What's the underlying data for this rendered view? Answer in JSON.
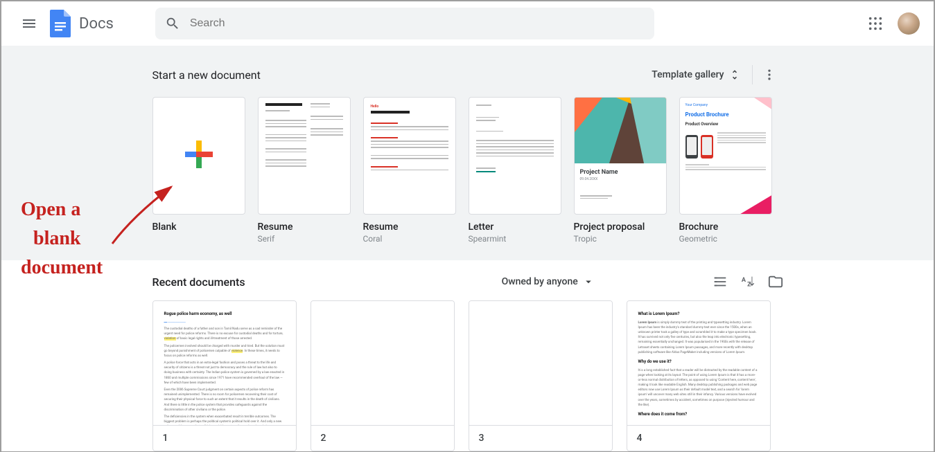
{
  "app": {
    "title": "Docs"
  },
  "search": {
    "placeholder": "Search"
  },
  "templates": {
    "section_title": "Start a new document",
    "gallery_label": "Template gallery",
    "items": [
      {
        "name": "Blank",
        "sub": ""
      },
      {
        "name": "Resume",
        "sub": "Serif"
      },
      {
        "name": "Resume",
        "sub": "Coral"
      },
      {
        "name": "Letter",
        "sub": "Spearmint"
      },
      {
        "name": "Project proposal",
        "sub": "Tropic"
      },
      {
        "name": "Brochure",
        "sub": "Geometric"
      }
    ],
    "proposal_thumb_title": "Project Name",
    "brochure_thumb_company": "Your Company",
    "brochure_thumb_title": "Product Brochure",
    "brochure_thumb_overview": "Product Overview"
  },
  "recent": {
    "section_title": "Recent documents",
    "owned_label": "Owned by anyone",
    "items": [
      {
        "label": "1",
        "heading": "Rogue police harm economy, as well",
        "sub_h2": "",
        "sub_h3": ""
      },
      {
        "label": "2"
      },
      {
        "label": "3"
      },
      {
        "label": "4",
        "heading": "What is Lorem Ipsum?",
        "sub_h2": "Why do we use it?",
        "sub_h3": "Where does it come from?"
      }
    ]
  },
  "annotation": {
    "line1": "Open a",
    "line2": "blank",
    "line3": "document"
  }
}
